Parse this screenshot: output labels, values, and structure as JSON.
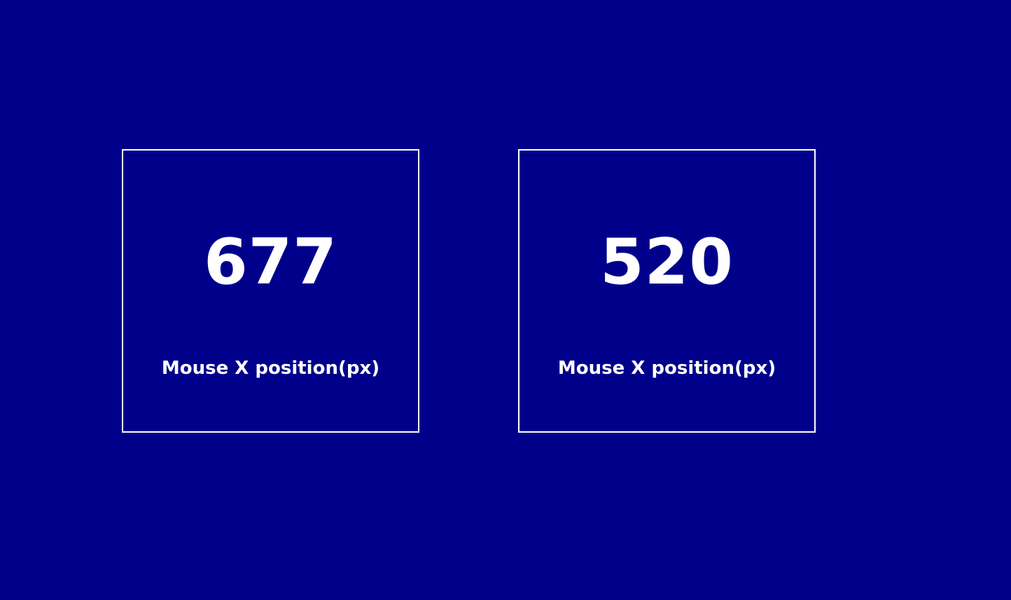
{
  "colors": {
    "background": "#00008b",
    "foreground": "#ffffff"
  },
  "cards": [
    {
      "value": "677",
      "label": "Mouse X position(px)"
    },
    {
      "value": "520",
      "label": "Mouse X position(px)"
    }
  ]
}
